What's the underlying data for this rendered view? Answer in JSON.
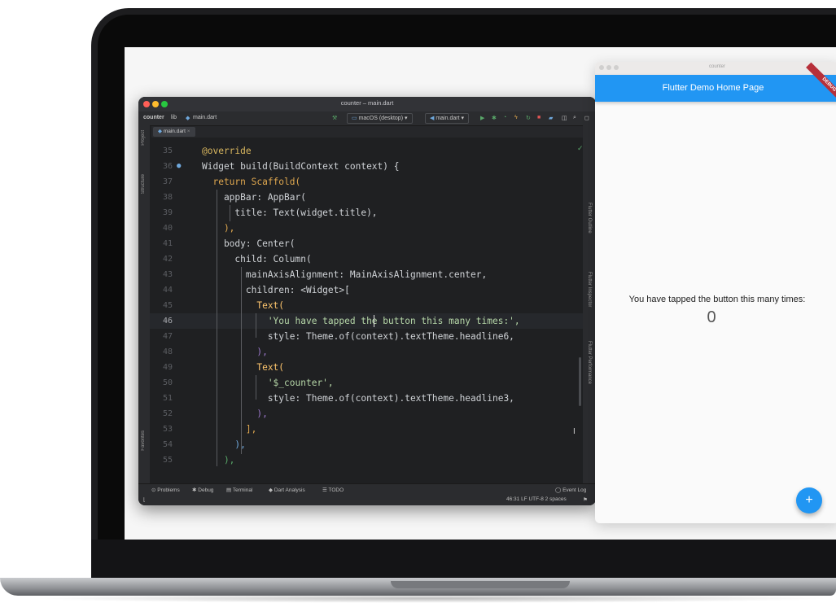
{
  "ide": {
    "window_title": "counter – main.dart",
    "project_label": "counter",
    "breadcrumb_sep": "lib",
    "breadcrumb_file": "main.dart",
    "device_selector": "macOS (desktop)",
    "run_config": "main.dart",
    "tab_label": "main.dart",
    "left_tools": [
      "Project",
      "Structure",
      "Favorites"
    ],
    "right_tools": [
      "Flutter Outline",
      "Flutter Inspector",
      "Flutter Performance"
    ],
    "code_lines": [
      {
        "n": "35",
        "text": "@override"
      },
      {
        "n": "36",
        "text": "Widget build(BuildContext context) {"
      },
      {
        "n": "37",
        "text": "  return Scaffold("
      },
      {
        "n": "38",
        "text": "    appBar: AppBar("
      },
      {
        "n": "39",
        "text": "      title: Text(widget.title),"
      },
      {
        "n": "40",
        "text": "    ),"
      },
      {
        "n": "41",
        "text": "    body: Center("
      },
      {
        "n": "42",
        "text": "      child: Column("
      },
      {
        "n": "43",
        "text": "        mainAxisAlignment: MainAxisAlignment.center,"
      },
      {
        "n": "44",
        "text": "        children: <Widget>["
      },
      {
        "n": "45",
        "text": "          Text("
      },
      {
        "n": "46",
        "text": "            'You have tapped the button this many times:',"
      },
      {
        "n": "47",
        "text": "            style: Theme.of(context).textTheme.headline6,"
      },
      {
        "n": "48",
        "text": "          ),"
      },
      {
        "n": "49",
        "text": "          Text("
      },
      {
        "n": "50",
        "text": "            '$_counter',"
      },
      {
        "n": "51",
        "text": "            style: Theme.of(context).textTheme.headline3,"
      },
      {
        "n": "52",
        "text": "          ),"
      },
      {
        "n": "53",
        "text": "        ],"
      },
      {
        "n": "54",
        "text": "      ),"
      },
      {
        "n": "55",
        "text": "    ),"
      }
    ],
    "bottom_tools": [
      "Problems",
      "Debug",
      "Terminal",
      "Dart Analysis",
      "TODO"
    ],
    "event_log": "Event Log",
    "status": "46:31  LF  UTF-8  2 spaces"
  },
  "app": {
    "window_title": "counter",
    "appbar_title": "Flutter Demo Home Page",
    "debug_banner": "DEBUG",
    "message": "You have tapped the button this many times:",
    "counter": "0",
    "fab_label": "+"
  },
  "colors": {
    "accent": "#2196f3",
    "ide_background": "#1f2022",
    "debug_banner": "#b7303a"
  }
}
